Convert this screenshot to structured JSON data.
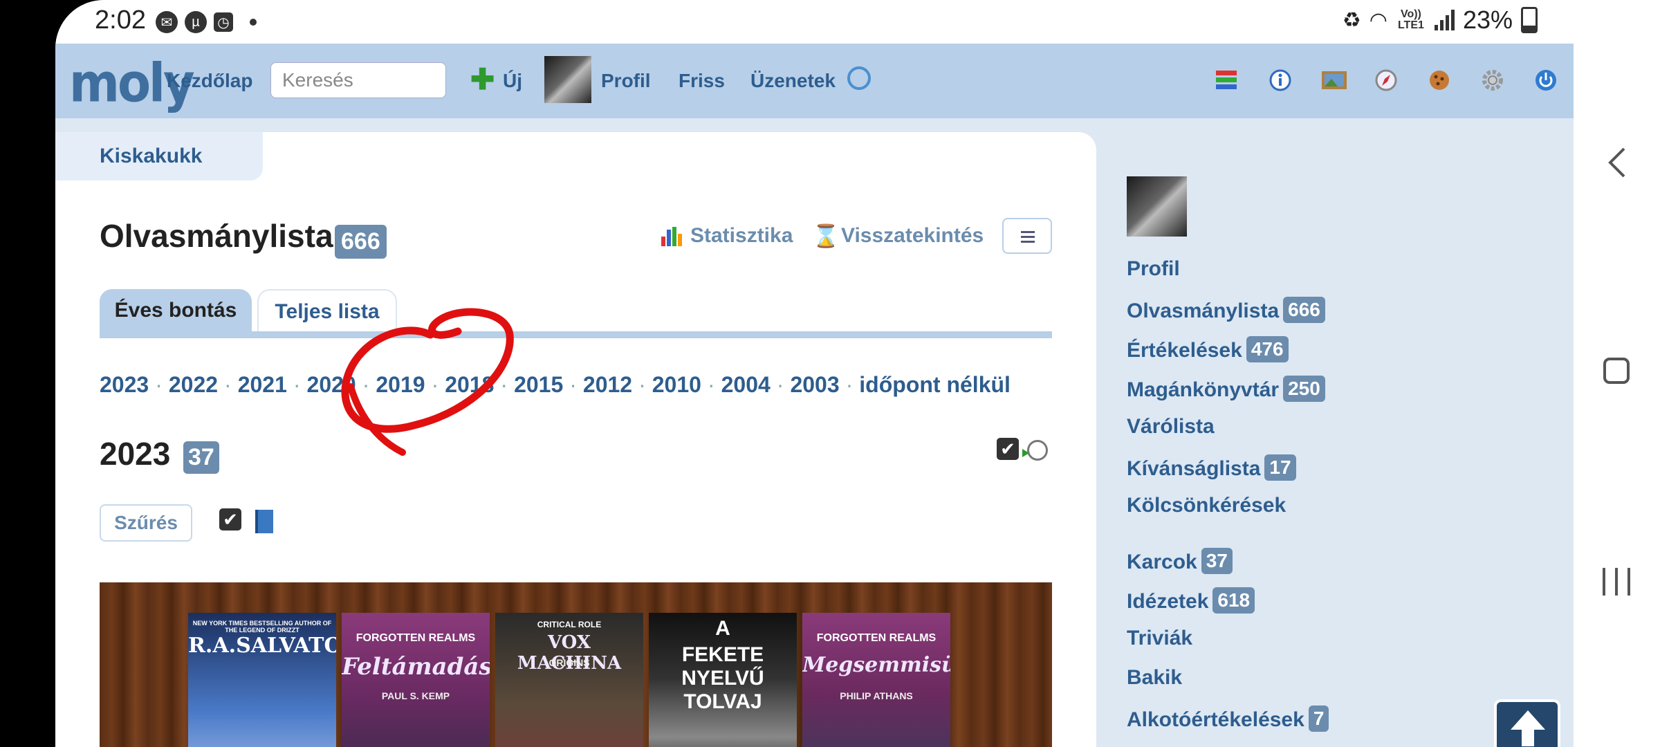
{
  "status_bar": {
    "time": "2:02",
    "network": "Vo)) LTE1",
    "battery": "23%"
  },
  "header": {
    "logo": "moly",
    "home": "Kezdőlap",
    "search_placeholder": "Keresés",
    "new": "Új",
    "profile": "Profil",
    "fresh": "Friss",
    "messages": "Üzenetek",
    "icons": [
      "list-icon",
      "info-icon",
      "image-icon",
      "compass-icon",
      "cookie-icon",
      "gear-icon",
      "power-icon"
    ]
  },
  "breadcrumb": "Kiskakukk",
  "page": {
    "title": "Olvasmánylista",
    "count": "666",
    "stats_link": "Statisztika",
    "retro_link": "Visszatekintés"
  },
  "tabs": [
    {
      "label": "Éves bontás",
      "active": true
    },
    {
      "label": "Teljes lista",
      "active": false
    }
  ],
  "years": [
    "2023",
    "2022",
    "2021",
    "2020",
    "2019",
    "2018",
    "2015",
    "2012",
    "2010",
    "2004",
    "2003",
    "időpont nélkül"
  ],
  "section": {
    "year": "2023",
    "count": "37",
    "filter_label": "Szűrés"
  },
  "books": [
    {
      "top": "NEW YORK TIMES BESTSELLING AUTHOR OF THE LEGEND OF DRIZZT",
      "title": "R.A.SALVATORE",
      "sub": "",
      "color": "#2b4f8a"
    },
    {
      "top": "FORGOTTEN REALMS",
      "title": "Feltámadás",
      "sub": "PAUL S. KEMP",
      "color": "#7a2a62"
    },
    {
      "top": "CRITICAL ROLE",
      "title": "VOX MACHINA",
      "sub": "ORIGINS",
      "color": "#3a3a3a"
    },
    {
      "top": "A",
      "title": "FEKETE NYELVŰ TOLVAJ",
      "sub": "",
      "color": "#1a1a1a"
    },
    {
      "top": "FORGOTTEN REALMS",
      "title": "Megsemmisülés",
      "sub": "PHILIP ATHANS",
      "color": "#6a2a5e"
    }
  ],
  "sidebar": [
    {
      "label": "Profil",
      "count": null
    },
    {
      "label": "Olvasmánylista",
      "count": "666"
    },
    {
      "label": "Értékelések",
      "count": "476"
    },
    {
      "label": "Magánkönyvtár",
      "count": "250"
    },
    {
      "label": "Várólista",
      "count": null
    },
    {
      "label": "Kívánságlista",
      "count": "17"
    },
    {
      "label": "Kölcsönkérések",
      "count": null
    },
    {
      "label": "Karcok",
      "count": "37"
    },
    {
      "label": "Idézetek",
      "count": "618"
    },
    {
      "label": "Triviák",
      "count": null
    },
    {
      "label": "Bakik",
      "count": null
    },
    {
      "label": "Alkotóértékelések",
      "count": "7"
    }
  ]
}
